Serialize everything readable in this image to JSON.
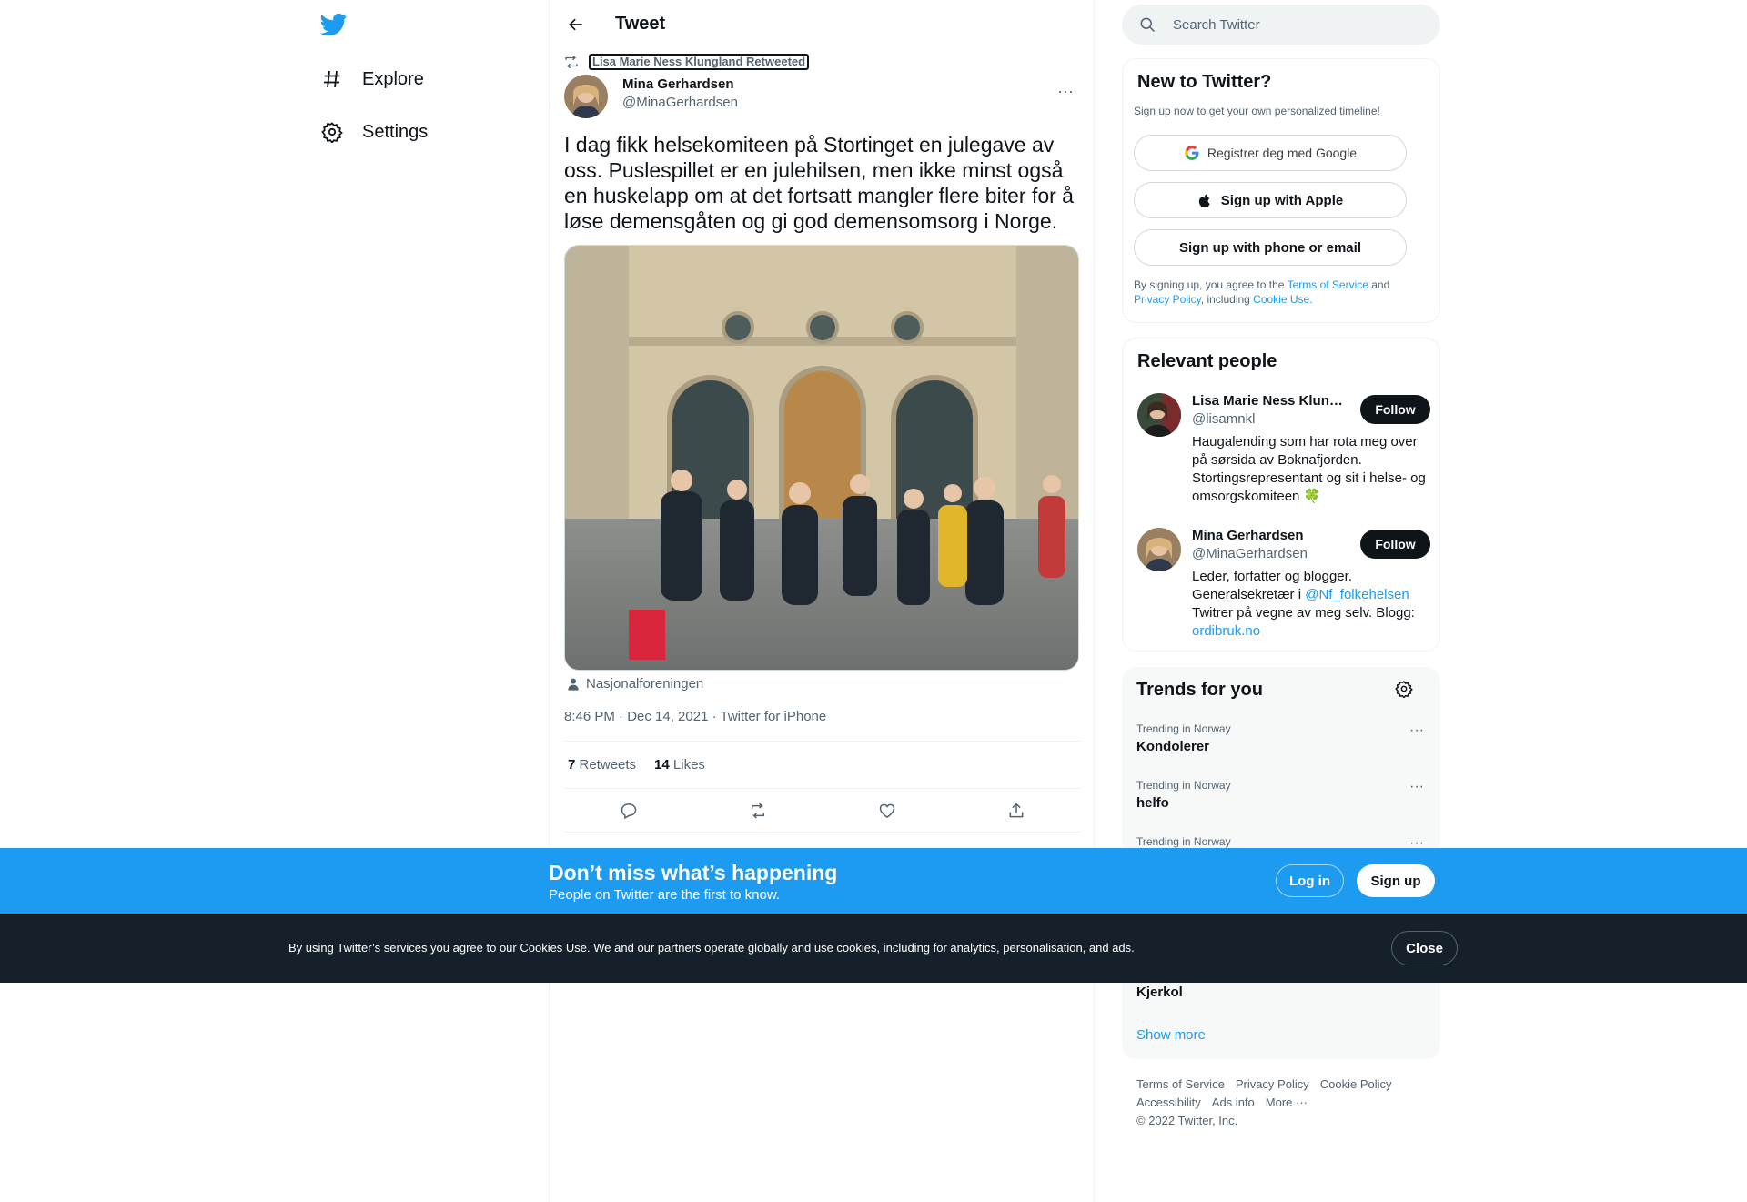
{
  "nav": {
    "explore_label": "Explore",
    "settings_label": "Settings"
  },
  "header": {
    "title": "Tweet"
  },
  "tweet": {
    "retweeted_by": "Lisa Marie Ness Klungland Retweeted",
    "author_name": "Mina Gerhardsen",
    "author_handle": "@MinaGerhardsen",
    "text": "I dag fikk helsekomiteen på Stortinget en julegave av oss. Puslespillet er en julehilsen, men ikke minst også en huskelapp om at det fortsatt mangler flere biter for å løse demensgåten og gi god demensomsorg i Norge.",
    "tagged": "Nasjonalforeningen",
    "time": "8:46 PM · Dec 14, 2021",
    "separator": " · ",
    "source": "Twitter for iPhone",
    "retweets_count": "7",
    "retweets_label": "Retweets",
    "likes_count": "14",
    "likes_label": "Likes"
  },
  "search": {
    "placeholder": "Search Twitter"
  },
  "new_to_twitter": {
    "title": "New to Twitter?",
    "subtitle": "Sign up now to get your own personalized timeline!",
    "google_label": "Registrer deg med Google",
    "apple_label": "Sign up with Apple",
    "phone_label": "Sign up with phone or email",
    "legal_1": "By signing up, you agree to the ",
    "terms": "Terms of Service",
    "legal_2": " and ",
    "privacy": "Privacy Policy",
    "legal_3": ", including ",
    "cookie": "Cookie Use."
  },
  "relevant_people": {
    "title": "Relevant people",
    "people": [
      {
        "name": "Lisa Marie Ness Klungland",
        "handle": "@lisamnkl",
        "bio": "Haugalending som har rota meg over på sørsida av Boknafjorden. Stortingsrepresentant og sit i helse- og omsorgskomiteen 🍀",
        "follow_label": "Follow"
      },
      {
        "name": "Mina Gerhardsen",
        "handle": "@MinaGerhardsen",
        "bio_1": "Leder, forfatter og blogger. Generalsekretær i ",
        "bio_link": "@Nf_folkehelsen",
        "bio_2": " Twitrer på vegne av meg selv. Blogg: ",
        "bio_link2": "ordibruk.no",
        "follow_label": "Follow"
      }
    ]
  },
  "trends": {
    "title": "Trends for you",
    "items": [
      {
        "context": "Trending in Norway",
        "name": "Kondolerer"
      },
      {
        "context": "Trending in Norway",
        "name": "helfo"
      },
      {
        "context": "Trending in Norway",
        "name": ""
      },
      {
        "context": "",
        "name": "Kjerkol"
      }
    ],
    "show_more": "Show more"
  },
  "footer": {
    "terms": "Terms of Service",
    "privacy": "Privacy Policy",
    "cookie": "Cookie Policy",
    "accessibility": "Accessibility",
    "ads": "Ads info",
    "more": "More ···",
    "copyright": "© 2022 Twitter, Inc."
  },
  "signup_bar": {
    "heading": "Don’t miss what’s happening",
    "subheading": "People on Twitter are the first to know.",
    "login_label": "Log in",
    "signup_label": "Sign up"
  },
  "cookie_bar": {
    "text": "By using Twitter’s services you agree to our Cookies Use. We and our partners operate globally and use cookies, including for analytics, personalisation, and ads.",
    "close_label": "Close"
  },
  "colors": {
    "brand": "#1d9bf0",
    "text": "#0f1419",
    "muted": "#536471",
    "cookie_bg": "#15202b"
  }
}
